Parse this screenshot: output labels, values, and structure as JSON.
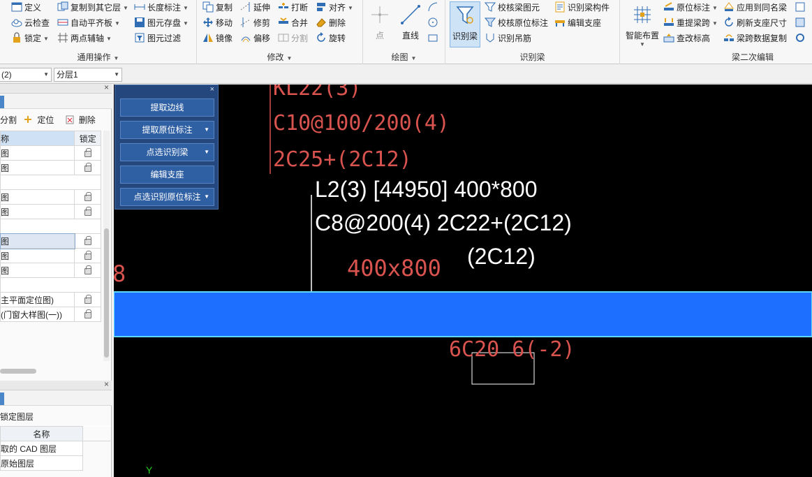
{
  "ribbon": {
    "g1": {
      "define": "定义",
      "cloud_check": "云检查",
      "lock": "锁定",
      "copy_to_other_layer": "复制到其它层",
      "auto_level_slab": "自动平齐板",
      "two_point_axis": "两点辅轴",
      "length_dim": "长度标注",
      "element_save": "图元存盘",
      "element_filter": "图元过滤",
      "label": "通用操作"
    },
    "g2": {
      "copy": "复制",
      "extend": "延伸",
      "break": "打断",
      "align": "对齐",
      "move": "移动",
      "trim": "修剪",
      "merge": "合并",
      "delete": "删除",
      "mirror": "镜像",
      "offset": "偏移",
      "split": "分割",
      "rotate": "旋转",
      "label": "修改"
    },
    "g3": {
      "point": "点",
      "line": "直线",
      "label": "绘图"
    },
    "g4": {
      "identify_beam": "识别梁",
      "check_beam_element": "校核梁图元",
      "check_origin_mark": "校核原位标注",
      "identify_hanger": "识别吊筋",
      "identify_beam_member": "识别梁构件",
      "edit_support": "编辑支座",
      "label": "识别梁"
    },
    "g5": {
      "smart_layout": "智能布置",
      "origin_mark": "原位标注",
      "re_extract_span": "重提梁跨",
      "check_elevation": "查改标高",
      "apply_same_name": "应用到同名梁",
      "refresh_support_size": "刷新支座尺寸",
      "span_data_copy": "梁跨数据复制",
      "label": "梁二次编辑"
    }
  },
  "selectors": {
    "floor": "(2)",
    "sublayer": "分层1"
  },
  "left_panel": {
    "tools": {
      "split": "分割",
      "locate": "定位",
      "delete": "删除"
    },
    "headers": {
      "name": "称",
      "lock": "锁定"
    },
    "rows": [
      "图",
      "图",
      "",
      "图",
      "图",
      "",
      "图",
      "图",
      "图",
      "",
      "主平面定位图)",
      "(门窗大样图(一))"
    ],
    "bottom_title": "锁定图层",
    "bottom_header": "名称",
    "bottom_rows": [
      "取的 CAD 图层",
      "原始图层"
    ]
  },
  "float_panel": {
    "buttons": [
      "提取边线",
      "提取原位标注",
      "点选识别梁",
      "编辑支座",
      "点选识别原位标注"
    ]
  },
  "canvas": {
    "red_labels": [
      "KL22(3)",
      "C10@100/200(4)",
      "2C25+(2C12)",
      "400x800",
      "8",
      "6C20 6(-2)"
    ],
    "white_labels": [
      "L2(3) [44950] 400*800",
      "C8@200(4) 2C22+(2C12)",
      "(2C12)"
    ],
    "axis_label": "Y",
    "colors": {
      "beam_fill": "#1d6fff",
      "beam_edge": "#5fd8ff",
      "cad_red": "#d9534f"
    }
  }
}
